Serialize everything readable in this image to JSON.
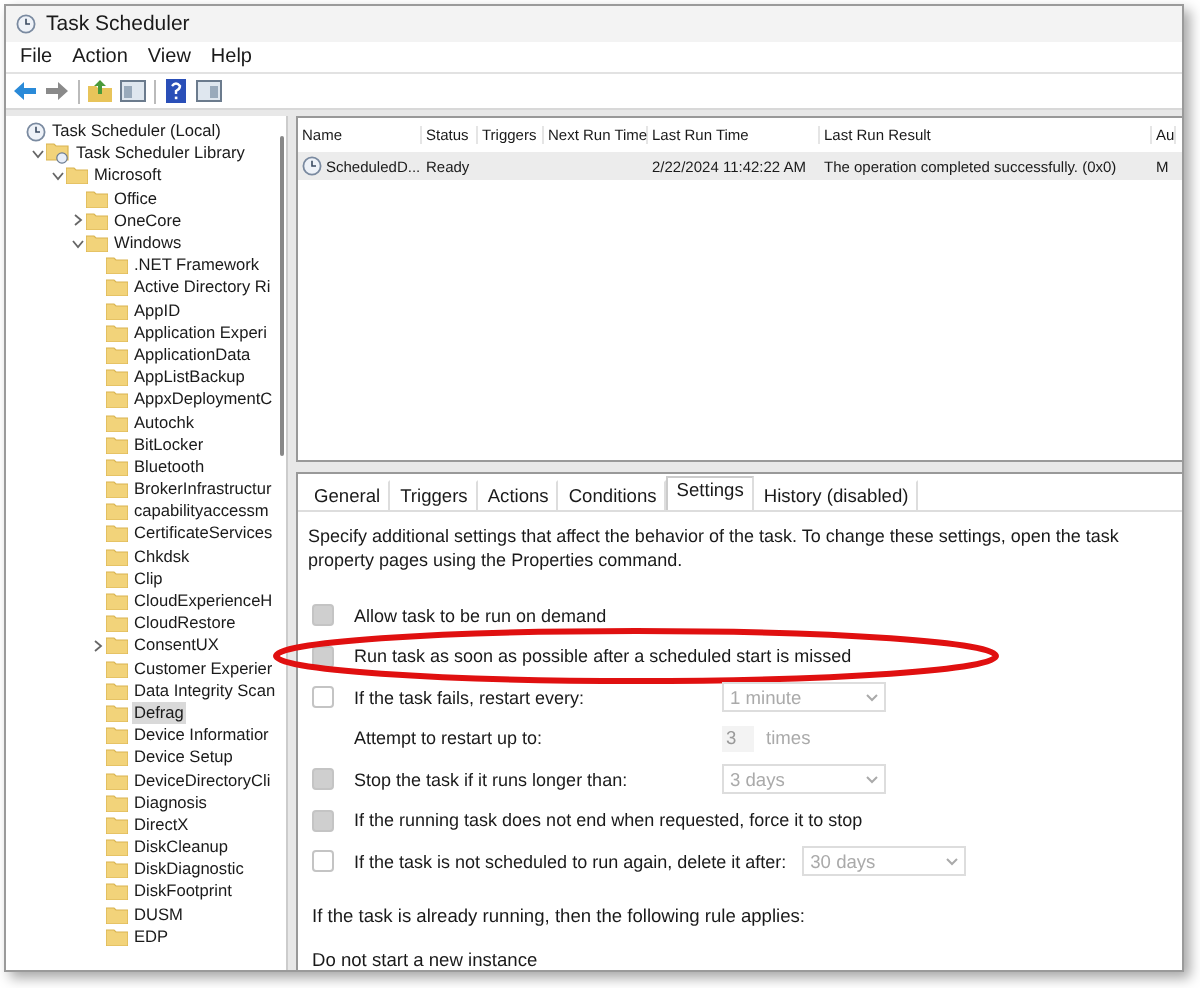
{
  "window": {
    "title": "Task Scheduler"
  },
  "menu": [
    "File",
    "Action",
    "View",
    "Help"
  ],
  "tree": [
    {
      "label": "Task Scheduler (Local)",
      "kind": "clock",
      "selected": false,
      "children": [
        {
          "label": "Task Scheduler Library",
          "kind": "library",
          "expanded": true,
          "selected": false,
          "children": [
            {
              "label": "Microsoft",
              "kind": "folder",
              "expanded": true,
              "selected": false,
              "children": [
                {
                  "label": "Office",
                  "kind": "folder",
                  "selected": false
                },
                {
                  "label": "OneCore",
                  "kind": "folder",
                  "expanded": false,
                  "selected": false
                },
                {
                  "label": "Windows",
                  "kind": "folder",
                  "expanded": true,
                  "selected": false,
                  "children": [
                    {
                      "label": ".NET Framework",
                      "kind": "folder",
                      "selected": false
                    },
                    {
                      "label": "Active Directory Ri",
                      "kind": "folder",
                      "selected": false
                    },
                    {
                      "label": "AppID",
                      "kind": "folder",
                      "selected": false
                    },
                    {
                      "label": "Application Experi",
                      "kind": "folder",
                      "selected": false
                    },
                    {
                      "label": "ApplicationData",
                      "kind": "folder",
                      "selected": false
                    },
                    {
                      "label": "AppListBackup",
                      "kind": "folder",
                      "selected": false
                    },
                    {
                      "label": "AppxDeploymentC",
                      "kind": "folder",
                      "selected": false
                    },
                    {
                      "label": "Autochk",
                      "kind": "folder",
                      "selected": false
                    },
                    {
                      "label": "BitLocker",
                      "kind": "folder",
                      "selected": false
                    },
                    {
                      "label": "Bluetooth",
                      "kind": "folder",
                      "selected": false
                    },
                    {
                      "label": "BrokerInfrastructur",
                      "kind": "folder",
                      "selected": false
                    },
                    {
                      "label": "capabilityaccessm",
                      "kind": "folder",
                      "selected": false
                    },
                    {
                      "label": "CertificateServices",
                      "kind": "folder",
                      "selected": false
                    },
                    {
                      "label": "Chkdsk",
                      "kind": "folder",
                      "selected": false
                    },
                    {
                      "label": "Clip",
                      "kind": "folder",
                      "selected": false
                    },
                    {
                      "label": "CloudExperienceH",
                      "kind": "folder",
                      "selected": false
                    },
                    {
                      "label": "CloudRestore",
                      "kind": "folder",
                      "selected": false
                    },
                    {
                      "label": "ConsentUX",
                      "kind": "folder",
                      "expanded": false,
                      "selected": false
                    },
                    {
                      "label": "Customer Experier",
                      "kind": "folder",
                      "selected": false
                    },
                    {
                      "label": "Data Integrity Scan",
                      "kind": "folder",
                      "selected": false
                    },
                    {
                      "label": "Defrag",
                      "kind": "folder",
                      "selected": true
                    },
                    {
                      "label": "Device Informatior",
                      "kind": "folder",
                      "selected": false
                    },
                    {
                      "label": "Device Setup",
                      "kind": "folder",
                      "selected": false
                    },
                    {
                      "label": "DeviceDirectoryCli",
                      "kind": "folder",
                      "selected": false
                    },
                    {
                      "label": "Diagnosis",
                      "kind": "folder",
                      "selected": false
                    },
                    {
                      "label": "DirectX",
                      "kind": "folder",
                      "selected": false
                    },
                    {
                      "label": "DiskCleanup",
                      "kind": "folder",
                      "selected": false
                    },
                    {
                      "label": "DiskDiagnostic",
                      "kind": "folder",
                      "selected": false
                    },
                    {
                      "label": "DiskFootprint",
                      "kind": "folder",
                      "selected": false
                    },
                    {
                      "label": "DUSM",
                      "kind": "folder",
                      "selected": false
                    },
                    {
                      "label": "EDP",
                      "kind": "folder",
                      "selected": false
                    }
                  ]
                }
              ]
            }
          ]
        }
      ]
    }
  ],
  "task_table": {
    "columns": [
      "Name",
      "Status",
      "Triggers",
      "Next Run Time",
      "Last Run Time",
      "Last Run Result",
      "Au"
    ],
    "rows": [
      {
        "name": "ScheduledD...",
        "status": "Ready",
        "last_run_time": "2/22/2024 11:42:22 AM",
        "last_run_result": "The operation completed successfully. (0x0)",
        "column_7": "M",
        "selected": true
      }
    ]
  },
  "detail_tabs": [
    {
      "label": "General",
      "selected": false
    },
    {
      "label": "Triggers",
      "selected": false
    },
    {
      "label": "Actions",
      "selected": false
    },
    {
      "label": "Conditions",
      "selected": false
    },
    {
      "label": "Settings",
      "selected": true
    },
    {
      "label": "History (disabled)",
      "selected": false
    }
  ],
  "settings": {
    "description": "Specify additional settings that affect the behavior of the task. To change these settings, open the task property pages using the Properties command.",
    "options": [
      {
        "kind": "checkbox",
        "label": "Allow task to be run on demand",
        "checked": true,
        "highlighted": false
      },
      {
        "kind": "checkbox",
        "label": "Run task as soon as possible after a scheduled start is missed",
        "checked": true,
        "highlighted": true
      },
      {
        "kind": "checkbox",
        "label": "If the task fails, restart every:",
        "checked": false,
        "highlighted": false,
        "dropdown": "1 minute"
      },
      {
        "kind": "number",
        "label": "Attempt to restart up to:",
        "value": "3",
        "unit": "times",
        "highlighted": false
      },
      {
        "kind": "checkbox",
        "label": "Stop the task if it runs longer than:",
        "checked": true,
        "highlighted": false,
        "dropdown": "3 days"
      },
      {
        "kind": "checkbox",
        "label": "If the running task does not end when requested, force it to stop",
        "checked": true,
        "highlighted": false
      },
      {
        "kind": "checkbox",
        "label": "If the task is not scheduled to run again, delete it after:",
        "checked": false,
        "highlighted": false,
        "dropdown": "30 days"
      }
    ],
    "rule_label": "If the task is already running, then the following rule applies:",
    "rule_value": "Do not start a new instance"
  }
}
